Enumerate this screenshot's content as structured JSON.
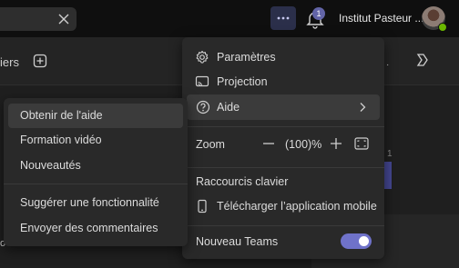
{
  "header": {
    "org_name": "Institut Pasteur ...",
    "notification_count": "1",
    "search_close_icon": "close-icon",
    "more_icon": "more-horizontal-icon"
  },
  "background": {
    "tab_fragment": "iers",
    "add_icon": "plus-square-icon",
    "more_text": "·",
    "side_number": "1",
    "bottom_fragment": "o"
  },
  "main_menu": {
    "settings_label": "Paramètres",
    "projection_label": "Projection",
    "help_label": "Aide",
    "zoom_label": "Zoom",
    "zoom_value": "(100)%",
    "shortcuts_label": "Raccourcis clavier",
    "download_label": "Télécharger l’application mobile",
    "new_teams_label": "Nouveau Teams",
    "new_teams_enabled": true
  },
  "help_submenu": {
    "items": [
      "Obtenir de l'aide",
      "Formation vidéo",
      "Nouveautés",
      "Suggérer une fonctionnalité",
      "Envoyer des commentaires"
    ]
  },
  "colors": {
    "accent": "#6264a7",
    "toggle_on": "#6f72c9",
    "presence": "#6bb700",
    "menu_bg": "#292929",
    "hover_bg": "#3b3b3b"
  }
}
